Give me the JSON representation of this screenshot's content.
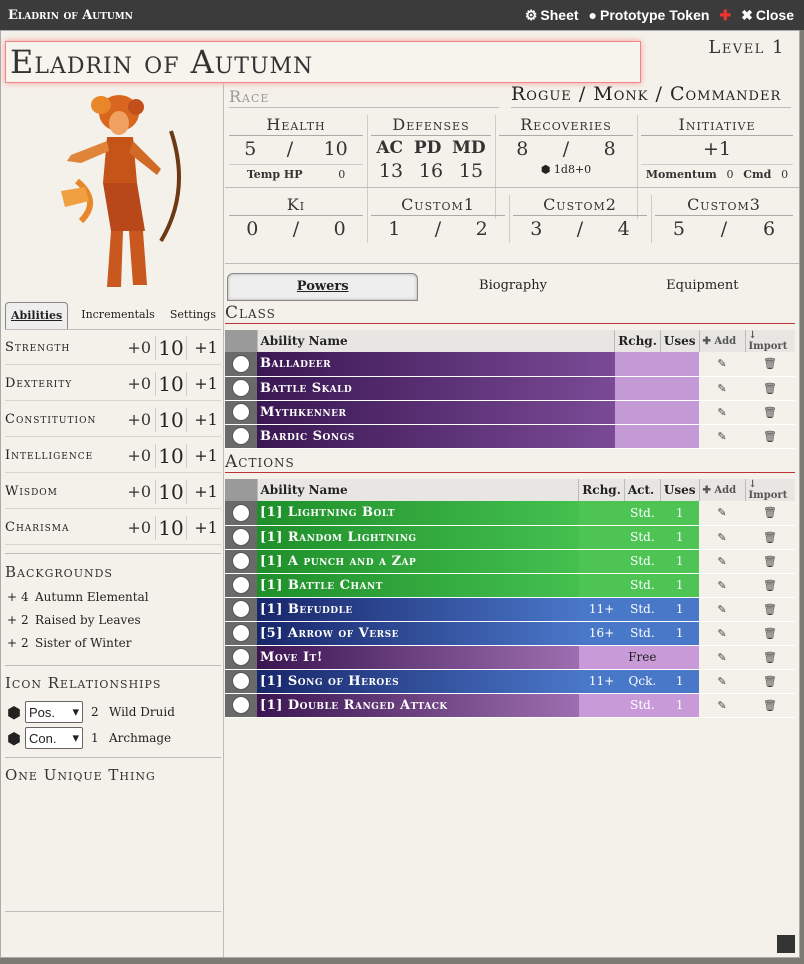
{
  "window": {
    "title": "Eladrin of Autumn",
    "sheet_label": "Sheet",
    "proto_label": "Prototype Token",
    "close_label": "Close"
  },
  "character": {
    "name": "Eladrin of Autumn",
    "level": "Level 1",
    "race_placeholder": "Race",
    "classes": "Rogue / Monk / Commander"
  },
  "left_tabs": [
    "Abilities",
    "Incrementals",
    "Settings"
  ],
  "abilities": [
    {
      "name": "Strength",
      "mod": "+0",
      "score": "10",
      "save": "+1"
    },
    {
      "name": "Dexterity",
      "mod": "+0",
      "score": "10",
      "save": "+1"
    },
    {
      "name": "Constitution",
      "mod": "+0",
      "score": "10",
      "save": "+1"
    },
    {
      "name": "Intelligence",
      "mod": "+0",
      "score": "10",
      "save": "+1"
    },
    {
      "name": "Wisdom",
      "mod": "+0",
      "score": "10",
      "save": "+1"
    },
    {
      "name": "Charisma",
      "mod": "+0",
      "score": "10",
      "save": "+1"
    }
  ],
  "backgrounds": {
    "title": "Backgrounds",
    "items": [
      {
        "plus": "+",
        "value": "4",
        "name": "Autumn Elemental"
      },
      {
        "plus": "+",
        "value": "2",
        "name": "Raised by Leaves"
      },
      {
        "plus": "+",
        "value": "2",
        "name": "Sister of Winter"
      }
    ]
  },
  "icons": {
    "title": "Icon Relationships",
    "items": [
      {
        "rel": "Pos.",
        "value": "2",
        "name": "Wild Druid"
      },
      {
        "rel": "Con.",
        "value": "1",
        "name": "Archmage"
      }
    ]
  },
  "unique": {
    "title": "One Unique Thing"
  },
  "stats": {
    "health": {
      "label": "Health",
      "cur": "5",
      "sep": "/",
      "max": "10",
      "temp_label": "Temp HP",
      "temp": "0"
    },
    "defenses": {
      "label": "Defenses",
      "ac_l": "AC",
      "pd_l": "PD",
      "md_l": "MD",
      "ac": "13",
      "pd": "16",
      "md": "15"
    },
    "recoveries": {
      "label": "Recoveries",
      "cur": "8",
      "sep": "/",
      "max": "8",
      "dice": "1d8+0"
    },
    "initiative": {
      "label": "Initiative",
      "value": "+1",
      "momentum_label": "Momentum",
      "momentum": "0",
      "cmd_label": "Cmd",
      "cmd": "0"
    },
    "ki": {
      "label": "Ki",
      "a": "0",
      "sep": "/",
      "b": "0"
    },
    "custom1": {
      "label": "Custom1",
      "a": "1",
      "sep": "/",
      "b": "2"
    },
    "custom2": {
      "label": "Custom2",
      "a": "3",
      "sep": "/",
      "b": "4"
    },
    "custom3": {
      "label": "Custom3",
      "a": "5",
      "sep": "/",
      "b": "6"
    }
  },
  "main_tabs": [
    "Powers",
    "Biography",
    "Equipment"
  ],
  "class_section": {
    "title": "Class",
    "headers": {
      "name": "Ability Name",
      "rchg": "Rchg.",
      "uses": "Uses",
      "add": "Add",
      "import": "Import"
    },
    "rows": [
      {
        "name": "Balladeer"
      },
      {
        "name": "Battle Skald"
      },
      {
        "name": "Mythkenner"
      },
      {
        "name": "Bardic Songs"
      }
    ]
  },
  "actions_section": {
    "title": "Actions",
    "headers": {
      "name": "Ability Name",
      "rchg": "Rchg.",
      "act": "Act.",
      "uses": "Uses",
      "add": "Add",
      "import": "Import"
    },
    "rows": [
      {
        "name": "[1] Lightning Bolt",
        "rchg": "",
        "act": "Std.",
        "uses": "1",
        "color": "green"
      },
      {
        "name": "[1] Random Lightning",
        "rchg": "",
        "act": "Std.",
        "uses": "1",
        "color": "green"
      },
      {
        "name": "[1] A punch and a Zap",
        "rchg": "",
        "act": "Std.",
        "uses": "1",
        "color": "green"
      },
      {
        "name": "[1] Battle Chant",
        "rchg": "",
        "act": "Std.",
        "uses": "1",
        "color": "green"
      },
      {
        "name": "[1] Befuddle",
        "rchg": "11+",
        "act": "Std.",
        "uses": "1",
        "color": "blue"
      },
      {
        "name": "[5] Arrow of Verse",
        "rchg": "16+",
        "act": "Std.",
        "uses": "1",
        "color": "blue"
      },
      {
        "name": "Move It!",
        "rchg": "",
        "act": "Free",
        "uses": "",
        "color": "pink"
      },
      {
        "name": "[1] Song of Heroes",
        "rchg": "11+",
        "act": "Qck.",
        "uses": "1",
        "color": "blue"
      },
      {
        "name": "[1] Double Ranged Attack",
        "rchg": "",
        "act": "Std.",
        "uses": "1",
        "color": "pink"
      }
    ]
  },
  "colors": {
    "class_row": "#5a2a78",
    "green": "#2fa83a",
    "blue": "#2a4a9a",
    "pink": "#9e6fb0"
  }
}
